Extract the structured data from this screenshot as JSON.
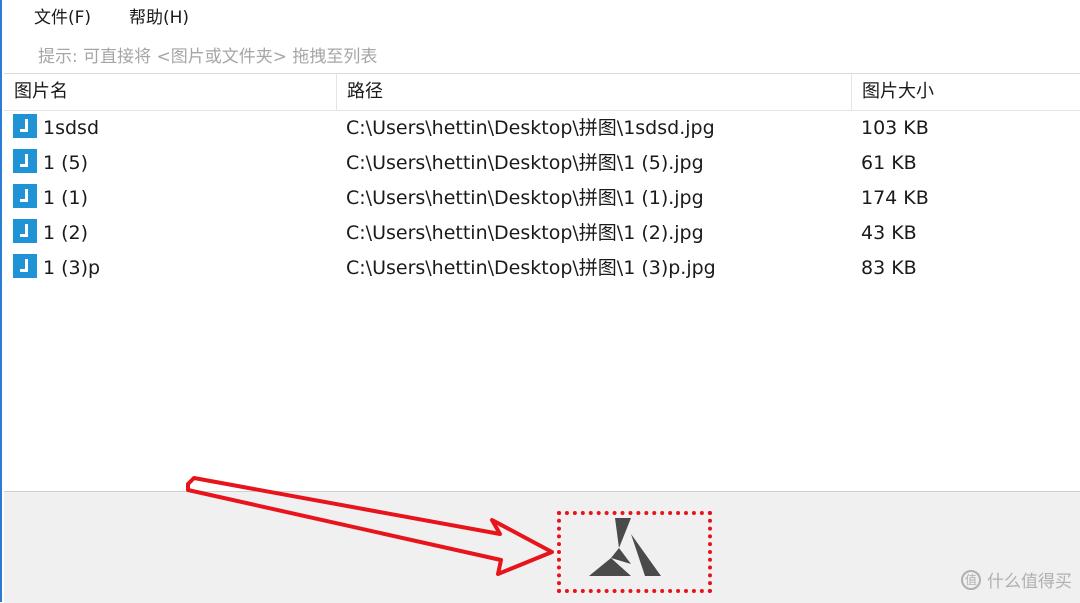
{
  "menu": {
    "file": "文件(F)",
    "help": "帮助(H)"
  },
  "hint": "提示: 可直接将 <图片或文件夹> 拖拽至列表",
  "table": {
    "columns": [
      "图片名",
      "路径",
      "图片大小"
    ],
    "rows": [
      {
        "name": "1sdsd",
        "path": "C:\\Users\\hettin\\Desktop\\拼图\\1sdsd.jpg",
        "size": "103 KB"
      },
      {
        "name": "1 (5)",
        "path": "C:\\Users\\hettin\\Desktop\\拼图\\1 (5).jpg",
        "size": "61 KB"
      },
      {
        "name": "1 (1)",
        "path": "C:\\Users\\hettin\\Desktop\\拼图\\1 (1).jpg",
        "size": "174 KB"
      },
      {
        "name": "1 (2)",
        "path": "C:\\Users\\hettin\\Desktop\\拼图\\1 (2).jpg",
        "size": "43 KB"
      },
      {
        "name": "1 (3)p",
        "path": "C:\\Users\\hettin\\Desktop\\拼图\\1 (3)p.jpg",
        "size": "83 KB"
      }
    ]
  },
  "icons": {
    "file": "image-file-icon",
    "logo": "app-logo-icon",
    "arrow": "red-arrow-annotation"
  },
  "colors": {
    "accent": "#2b7cd3",
    "file_icon": "#1f93d6",
    "annotation": "#e8141b",
    "logo": "#4a4a4a"
  },
  "watermark": "什么值得买"
}
